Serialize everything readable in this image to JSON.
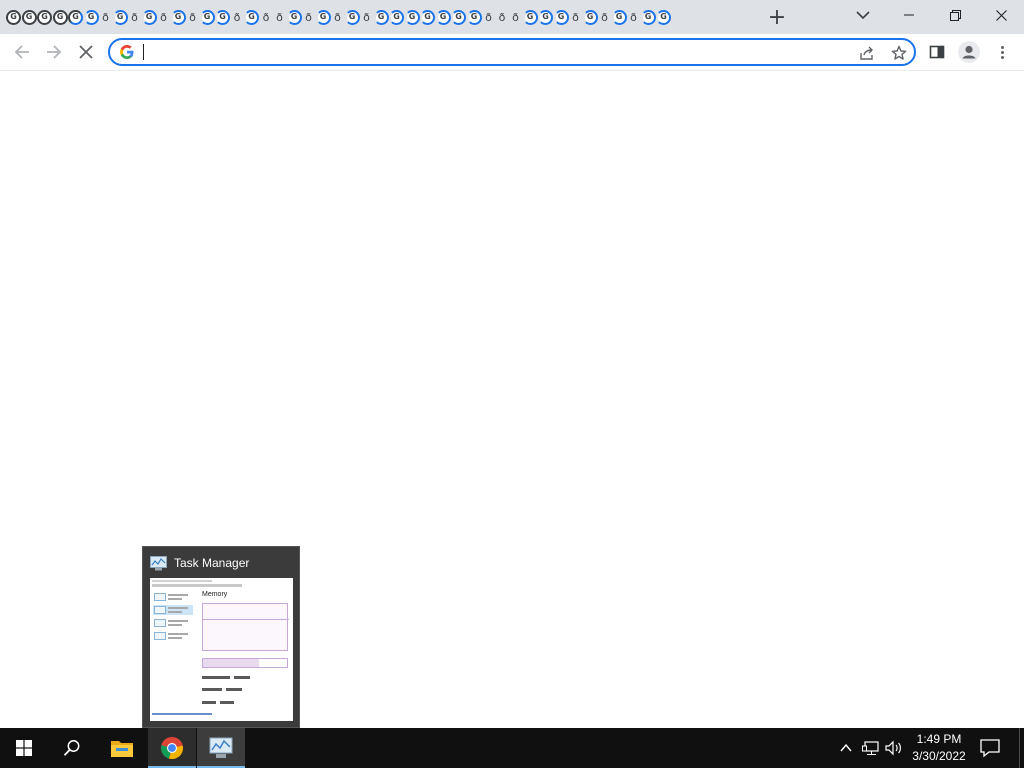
{
  "browser": {
    "tab_favicons": [
      "ghost",
      "ghost",
      "ghost",
      "ghost",
      "ghost-b",
      "spin",
      "plain",
      "spin",
      "plain",
      "spin",
      "plain",
      "spin",
      "plain",
      "spin",
      "spin",
      "plain",
      "spin",
      "plain",
      "plain",
      "spin",
      "plain",
      "spin",
      "plain",
      "spin",
      "plain",
      "spin",
      "spin",
      "spin",
      "spin",
      "spin",
      "spin",
      "spin",
      "plain",
      "plain",
      "plain",
      "spin",
      "spin",
      "spin",
      "plain",
      "spin",
      "plain",
      "spin",
      "plain",
      "spin",
      "spin"
    ],
    "new_tab_symbol": "+",
    "omnibox": {
      "value": "",
      "placeholder": ""
    }
  },
  "taskbar_preview": {
    "title": "Task Manager",
    "thumbnail_heading": "Memory"
  },
  "taskbar": {
    "clock_time": "1:49 PM",
    "clock_date": "3/30/2022"
  },
  "colors": {
    "accent": "#1a73e8",
    "tabstrip": "#dee1e6",
    "taskbar": "#101010",
    "taskbar_active_underline": "#76b9ed"
  },
  "icons": [
    "back-arrow-icon",
    "forward-arrow-icon",
    "stop-loading-icon",
    "google-g-icon",
    "share-icon",
    "star-icon",
    "side-panel-icon",
    "profile-icon",
    "kebab-menu-icon",
    "tab-search-icon",
    "minimize-icon",
    "restore-icon",
    "close-icon",
    "windows-start-icon",
    "search-icon",
    "file-explorer-icon",
    "chrome-icon",
    "task-manager-icon",
    "tray-chevron-icon",
    "network-icon",
    "volume-icon",
    "notification-icon"
  ]
}
